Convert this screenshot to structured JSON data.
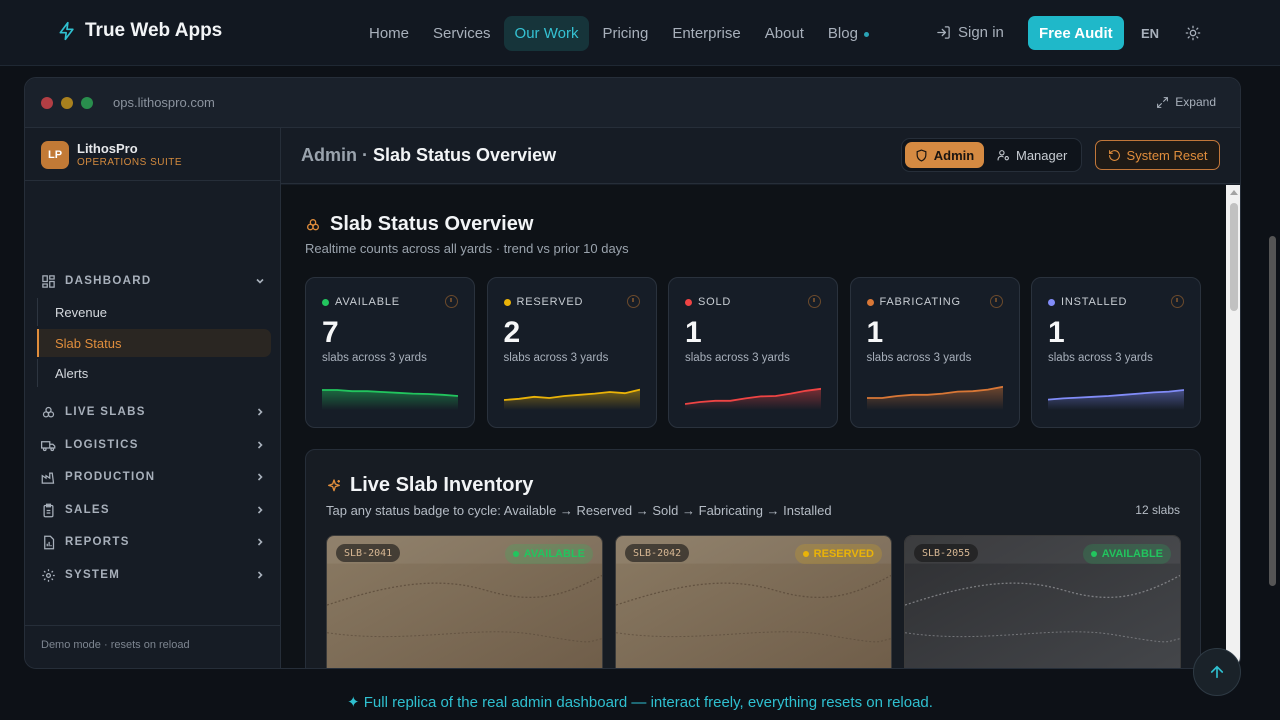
{
  "site": {
    "brand": "True Web Apps",
    "nav": [
      "Home",
      "Services",
      "Our Work",
      "Pricing",
      "Enterprise",
      "About",
      "Blog"
    ],
    "active_nav": "Our Work",
    "signin": "Sign in",
    "cta": "Free Audit",
    "lang": "EN",
    "accent": "#1fb8c9"
  },
  "window": {
    "url": "ops.lithospro.com",
    "expand": "Expand"
  },
  "sidebar": {
    "org_initials": "LP",
    "org_name": "LithosPro",
    "org_sub": "OPERATIONS SUITE",
    "sections": [
      {
        "label": "DASHBOARD",
        "icon": "dashboard-icon",
        "expanded": true
      },
      {
        "label": "LIVE SLABS",
        "icon": "layers-icon"
      },
      {
        "label": "LOGISTICS",
        "icon": "truck-icon"
      },
      {
        "label": "PRODUCTION",
        "icon": "factory-icon"
      },
      {
        "label": "SALES",
        "icon": "clipboard-icon"
      },
      {
        "label": "REPORTS",
        "icon": "report-icon"
      },
      {
        "label": "SYSTEM",
        "icon": "gear-icon"
      }
    ],
    "dashboard_items": [
      "Revenue",
      "Slab Status",
      "Alerts"
    ],
    "active_item": "Slab Status",
    "demo_note": "Demo mode · resets on reload"
  },
  "header": {
    "prefix": "Admin",
    "separator": "·",
    "title": "Slab Status Overview",
    "roles": [
      "Admin",
      "Manager"
    ],
    "active_role": "Admin",
    "reset": "System Reset"
  },
  "overview": {
    "title": "Slab Status Overview",
    "subtitle": "Realtime counts across all yards · trend vs prior 10 days",
    "stats": [
      {
        "label": "AVAILABLE",
        "value": "7",
        "desc": "slabs across 3 yards",
        "color": "#22c55e",
        "trend": [
          0.8,
          0.8,
          0.74,
          0.74,
          0.7,
          0.66,
          0.62,
          0.6,
          0.56,
          0.5
        ]
      },
      {
        "label": "RESERVED",
        "value": "2",
        "desc": "slabs across 3 yards",
        "color": "#eab308",
        "trend": [
          0.3,
          0.36,
          0.46,
          0.4,
          0.5,
          0.56,
          0.62,
          0.7,
          0.64,
          0.82
        ]
      },
      {
        "label": "SOLD",
        "value": "1",
        "desc": "slabs across 3 yards",
        "color": "#ef4444",
        "trend": [
          0.1,
          0.2,
          0.26,
          0.26,
          0.38,
          0.48,
          0.5,
          0.62,
          0.76,
          0.86
        ]
      },
      {
        "label": "FABRICATING",
        "value": "1",
        "desc": "slabs across 3 yards",
        "color": "#d97736",
        "trend": [
          0.4,
          0.4,
          0.5,
          0.56,
          0.56,
          0.62,
          0.72,
          0.74,
          0.82,
          0.96
        ]
      },
      {
        "label": "INSTALLED",
        "value": "1",
        "desc": "slabs across 3 yards",
        "color": "#818cf8",
        "trend": [
          0.32,
          0.38,
          0.42,
          0.46,
          0.5,
          0.56,
          0.62,
          0.68,
          0.72,
          0.8
        ]
      }
    ]
  },
  "inventory": {
    "title": "Live Slab Inventory",
    "subtitle": "Tap any status badge to cycle: Available → Reserved → Sold → Fabricating → Installed",
    "count": "12 slabs",
    "slabs": [
      {
        "id": "SLB-2041",
        "status": "AVAILABLE",
        "status_color": "#22c55e",
        "tone": "sand"
      },
      {
        "id": "SLB-2042",
        "status": "RESERVED",
        "status_color": "#eab308",
        "tone": "sand"
      },
      {
        "id": "SLB-2055",
        "status": "AVAILABLE",
        "status_color": "#22c55e",
        "tone": "grey"
      }
    ]
  },
  "footer": {
    "banner": "✦ Full replica of the real admin dashboard — interact freely, everything resets on reload."
  }
}
